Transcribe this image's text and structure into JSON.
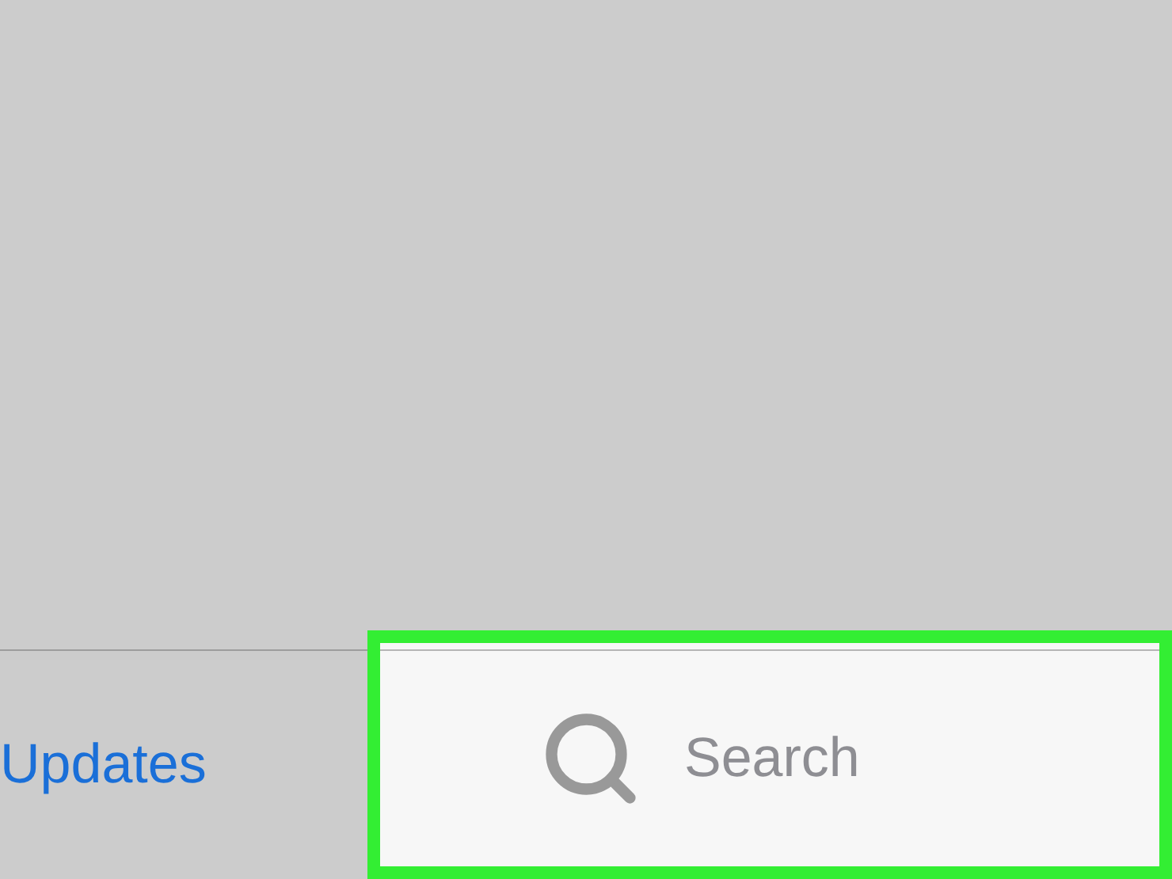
{
  "tab_bar": {
    "tabs": [
      {
        "label": "Updates",
        "selected": true,
        "highlighted": false
      },
      {
        "label": "Search",
        "selected": false,
        "highlighted": true
      }
    ]
  }
}
